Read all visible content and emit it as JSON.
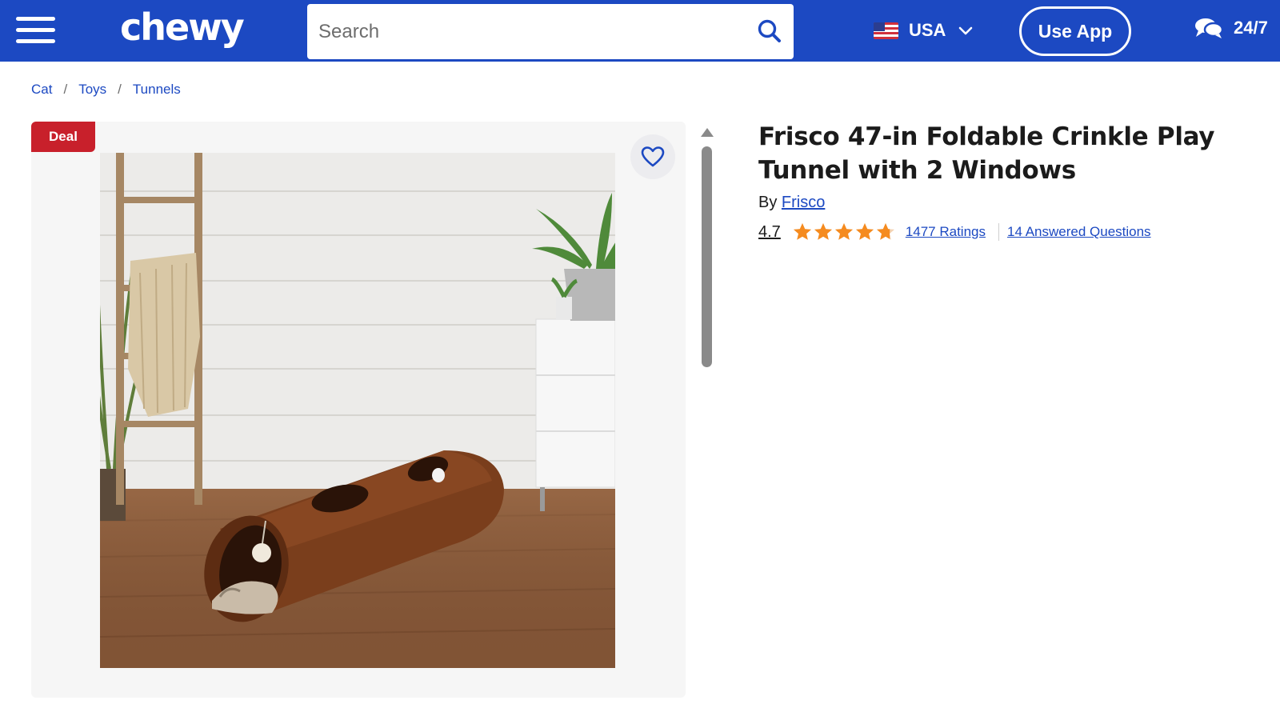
{
  "header": {
    "logo": "chewy",
    "search_placeholder": "Search",
    "country": "USA",
    "use_app": "Use App",
    "support": "24/7",
    "bg_color": "#1c49c2"
  },
  "breadcrumb": [
    {
      "label": "Cat"
    },
    {
      "label": "Toys"
    },
    {
      "label": "Tunnels"
    }
  ],
  "product": {
    "deal_badge": "Deal",
    "title": "Frisco 47-in Foldable Crinkle Play Tunnel with 2 Windows",
    "by_prefix": "By",
    "brand": "Frisco",
    "rating": "4.7",
    "rating_value": 4.7,
    "ratings_text": "1477 Ratings",
    "questions_text": "14 Answered Questions",
    "star_color": "#f58b1f",
    "link_color": "#1c49c2",
    "deal_color": "#c8202b"
  },
  "icons": {
    "menu": "hamburger-icon",
    "search": "search-icon",
    "flag": "us-flag-icon",
    "chevron": "chevron-down-icon",
    "chat": "chat-bubbles-icon",
    "favorite": "heart-icon",
    "star": "star-icon"
  }
}
